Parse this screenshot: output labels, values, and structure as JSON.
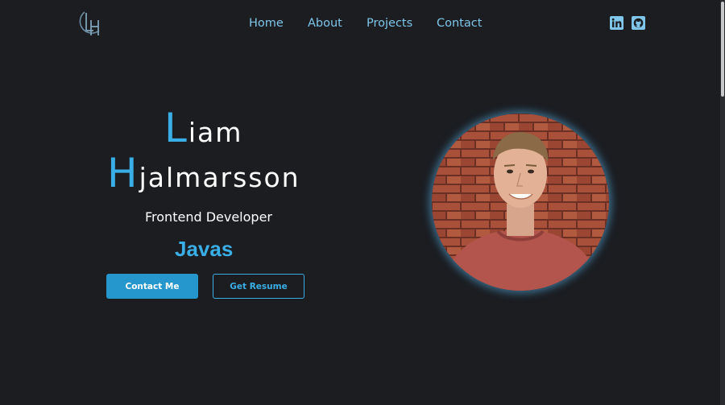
{
  "header": {
    "logo_icon": "lh-monogram-logo",
    "nav": [
      "Home",
      "About",
      "Projects",
      "Contact"
    ],
    "socials": [
      "linkedin-icon",
      "github-icon"
    ]
  },
  "hero": {
    "first_initial": "L",
    "first_rest": "iam",
    "last_initial": "H",
    "last_rest": "jalmarsson",
    "role": "Frontend Developer",
    "typed_text": "Javas",
    "contact_button": "Contact Me",
    "resume_button": "Get Resume",
    "portrait": "profile-photo"
  },
  "colors": {
    "background": "#1b1d21",
    "accent": "#3aaee6",
    "nav_text": "#7fc6ea",
    "primary_button": "#2597cc"
  }
}
